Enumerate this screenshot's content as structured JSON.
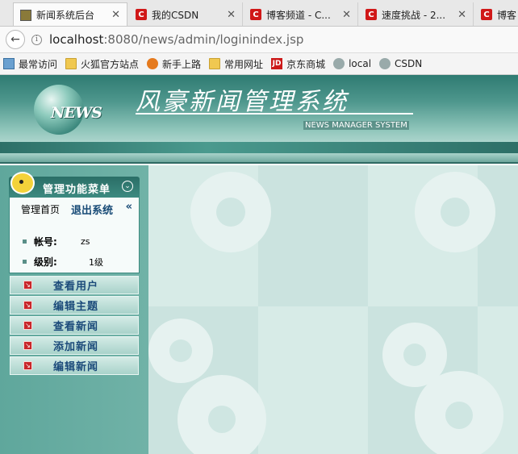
{
  "browser": {
    "tabs": [
      {
        "title": "新闻系统后台",
        "favicon": "news-favicon",
        "active": true
      },
      {
        "title": "我的CSDN",
        "favicon": "csdn-favicon",
        "active": false
      },
      {
        "title": "博客频道 - C...",
        "favicon": "csdn-favicon",
        "active": false
      },
      {
        "title": "速度挑战 - 2...",
        "favicon": "csdn-favicon",
        "active": false
      },
      {
        "title": "博客频",
        "favicon": "csdn-favicon",
        "active": false
      }
    ],
    "close_glyph": "✕",
    "url_host": "localhost",
    "url_rest": ":8080/news/admin/loginindex.jsp",
    "bookmarks": [
      {
        "label": "最常访问",
        "icon": "most-visited-icon"
      },
      {
        "label": "火狐官方站点",
        "icon": "folder-icon"
      },
      {
        "label": "新手上路",
        "icon": "firefox-icon"
      },
      {
        "label": "常用网址",
        "icon": "folder-icon"
      },
      {
        "label": "京东商城",
        "icon": "jd-icon"
      },
      {
        "label": "local",
        "icon": "globe-icon"
      },
      {
        "label": "CSDN",
        "icon": "globe-icon"
      }
    ]
  },
  "header": {
    "logo_text": "NEWS",
    "title": "风豪新闻管理系统",
    "subtitle": "NEWS MANAGER SYSTEM"
  },
  "menu": {
    "title": "管理功能菜单",
    "home_tab": "管理首页",
    "logout_tab": "退出系统",
    "user_info": [
      {
        "key": "帐号:",
        "value": "zs"
      },
      {
        "key": "级别:",
        "value": "1级"
      }
    ],
    "items": [
      {
        "label": "查看用户"
      },
      {
        "label": "编辑主题"
      },
      {
        "label": "查看新闻"
      },
      {
        "label": "添加新闻"
      },
      {
        "label": "编辑新闻"
      }
    ]
  },
  "colors": {
    "menu_text": "#1b4a7a",
    "banner_dark": "#2f7b72",
    "main_bg": "#cfe6e2"
  }
}
